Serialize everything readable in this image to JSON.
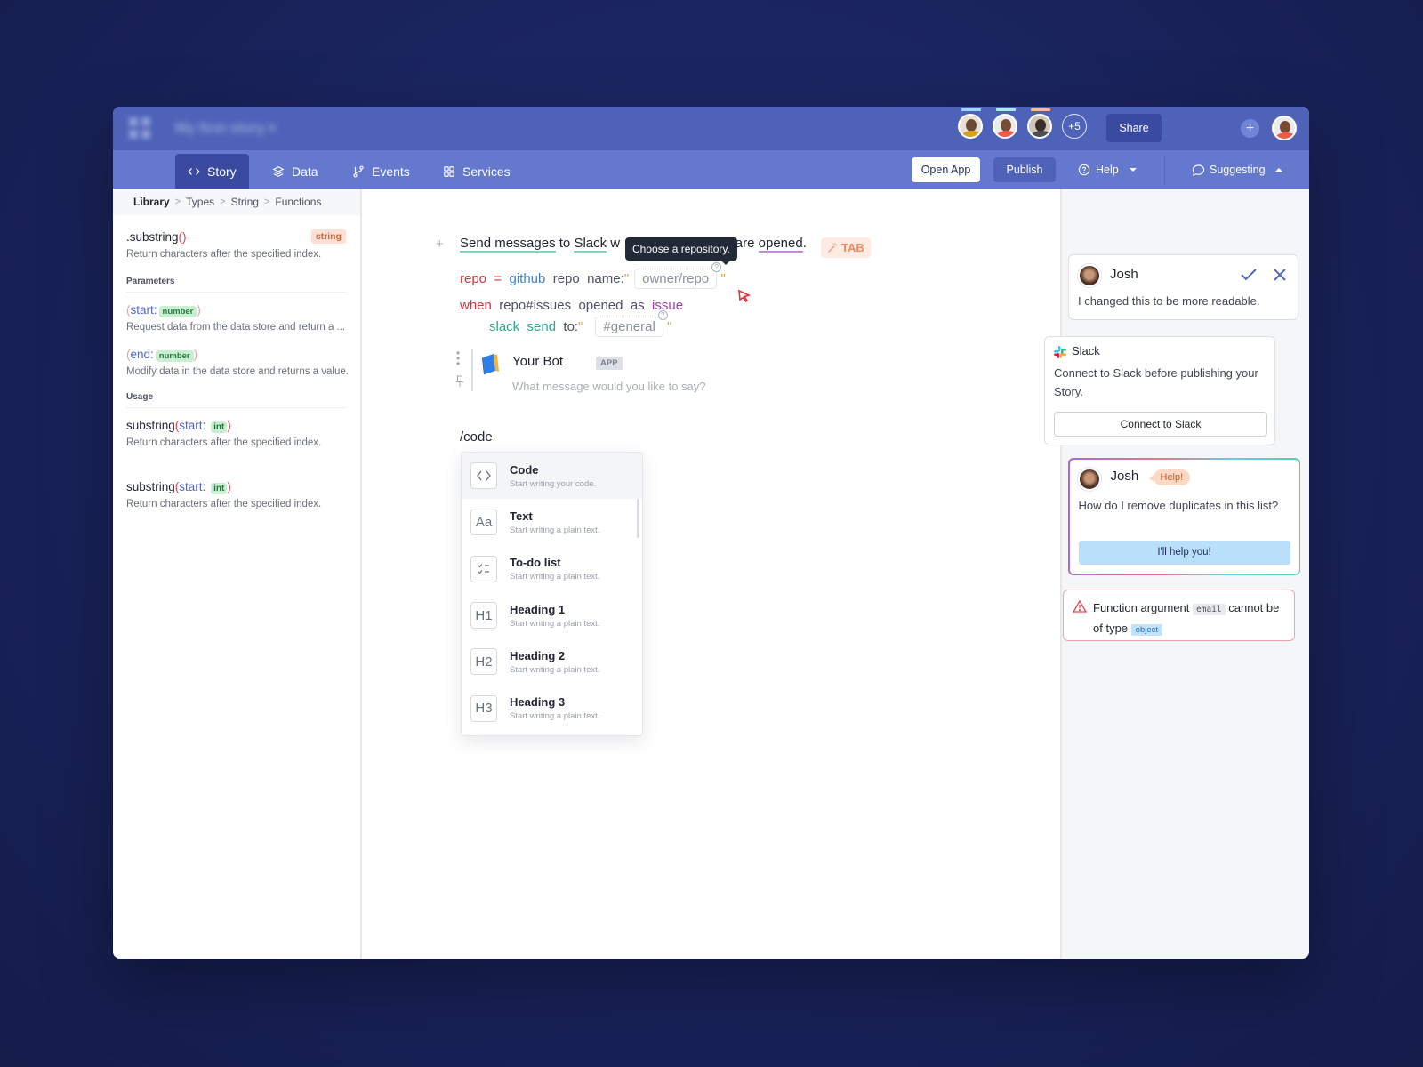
{
  "topbar": {
    "story_title": "My first story",
    "collaborators": [
      {
        "name": "collaborator-1",
        "presence_color": "#9fd6f5",
        "shirt": "#d9a021"
      },
      {
        "name": "collaborator-2",
        "presence_color": "#a7ecef",
        "shirt": "#ef5a4c"
      },
      {
        "name": "collaborator-3",
        "presence_color": "#f6b7a3",
        "shirt": "#4d4f55"
      }
    ],
    "more_count": "+5",
    "share_label": "Share"
  },
  "nav": {
    "tabs": [
      {
        "label": "Story",
        "icon": "code-icon",
        "active": true
      },
      {
        "label": "Data",
        "icon": "layers-icon",
        "active": false
      },
      {
        "label": "Events",
        "icon": "branch-icon",
        "active": false
      },
      {
        "label": "Services",
        "icon": "grid-icon",
        "active": false
      }
    ],
    "open_app_label": "Open App",
    "publish_label": "Publish",
    "help_label": "Help",
    "suggesting_label": "Suggesting"
  },
  "sidebar": {
    "breadcrumb": [
      "Library",
      "Types",
      "String",
      "Functions"
    ],
    "function": {
      "name": ".substring",
      "parens": "()",
      "return_type": "string",
      "description": "Return characters after the specified index."
    },
    "parameters_title": "Parameters",
    "parameters": [
      {
        "name": "start:",
        "type": "number",
        "description": "Request data from the data store and return a ..."
      },
      {
        "name": "end:",
        "type": "number",
        "description": "Modify data in the data store and returns a value."
      }
    ],
    "usage_title": "Usage",
    "usage": [
      {
        "fn": "substring",
        "arg": "start:",
        "type": "int",
        "description": "Return characters after the specified index."
      },
      {
        "fn": "substring",
        "arg": "start:",
        "type": "int",
        "description": "Return characters after the specified index."
      }
    ]
  },
  "editor": {
    "sentence": {
      "part1": "Send messages",
      "part2": " to ",
      "part3": "Slack",
      "part4": " w",
      "part5": "s are ",
      "part6": "opened",
      "part7": "."
    },
    "tooltip": "Choose a repository.",
    "tab_hint": "TAB",
    "code": {
      "line1": {
        "var": "repo",
        "op": "=",
        "service": "github",
        "kw": "repo",
        "arg": "name:",
        "quote": "\"",
        "placeholder": "owner/repo"
      },
      "line2": {
        "kw": "when",
        "event": "repo#issues",
        "action": "opened",
        "as": "as",
        "alias": "issue"
      },
      "line3": {
        "service": "slack",
        "action": "send",
        "arg": "to:",
        "quote": "\"",
        "placeholder": "#general"
      }
    },
    "bot": {
      "name": "Your Bot",
      "badge": "APP",
      "placeholder": "What message would you like to say?"
    },
    "slash_command": "/code",
    "menu": [
      {
        "title": "Code",
        "subtitle": "Start writing your code.",
        "icon": "<>"
      },
      {
        "title": "Text",
        "subtitle": "Start writing a plain text.",
        "icon": "Aa"
      },
      {
        "title": "To-do list",
        "subtitle": "Start writing a plain text.",
        "icon": "checklist"
      },
      {
        "title": "Heading 1",
        "subtitle": "Start writing a plain text.",
        "icon": "H1"
      },
      {
        "title": "Heading 2",
        "subtitle": "Start writing a plain text.",
        "icon": "H2"
      },
      {
        "title": "Heading 3",
        "subtitle": "Start writing a plain text.",
        "icon": "H3"
      }
    ]
  },
  "rightpanel": {
    "suggestion": {
      "author": "Josh",
      "text": "I changed this to be more readable."
    },
    "slack": {
      "title": "Slack",
      "text": "Connect to Slack before publishing your Story.",
      "button": "Connect to Slack"
    },
    "help_request": {
      "author": "Josh",
      "badge": "Help!",
      "text": "How do I remove duplicates in this list?",
      "button": "I'll help you!"
    },
    "error": {
      "text1": "Function argument",
      "code": "email",
      "text2": "cannot be of type",
      "type": "object"
    }
  }
}
